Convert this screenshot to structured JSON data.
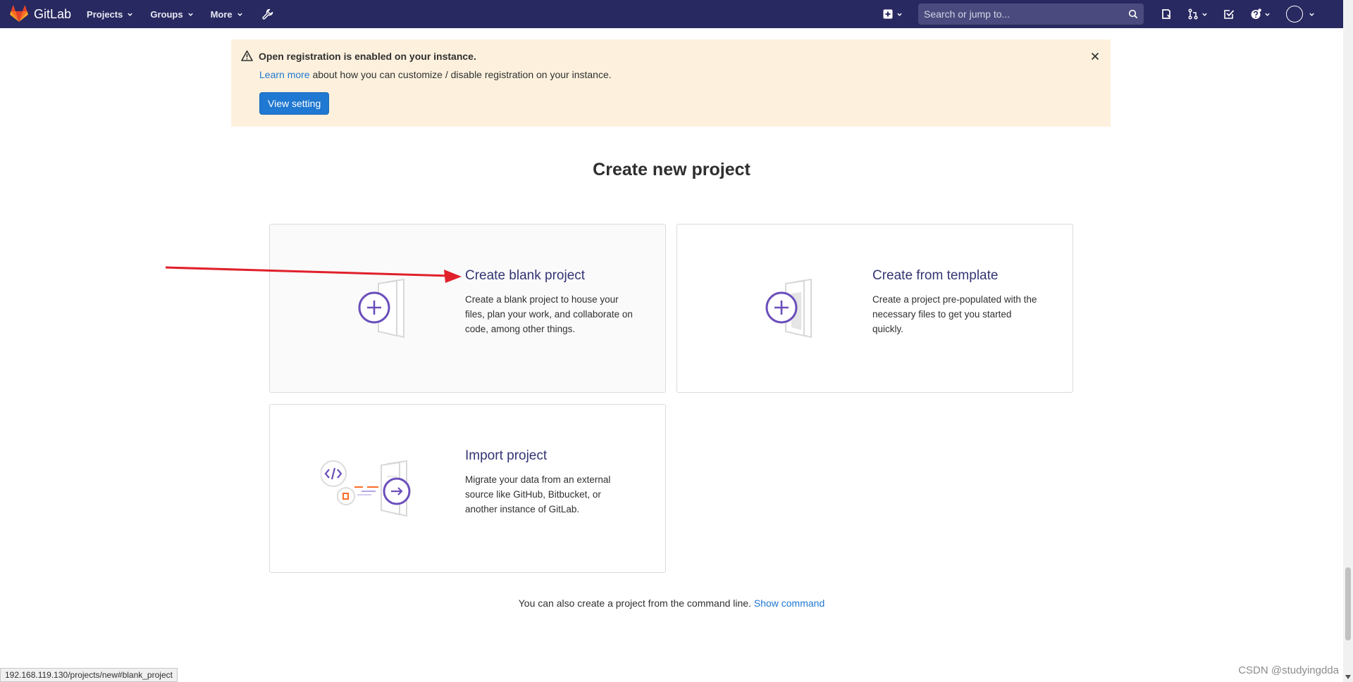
{
  "navbar": {
    "brand": "GitLab",
    "menus": [
      "Projects",
      "Groups",
      "More"
    ],
    "search_placeholder": "Search or jump to..."
  },
  "banner": {
    "title": "Open registration is enabled on your instance.",
    "link": "Learn more",
    "text": "about how you can customize / disable registration on your instance.",
    "button": "View setting"
  },
  "page": {
    "title": "Create new project"
  },
  "cards": {
    "blank": {
      "title": "Create blank project",
      "desc": "Create a blank project to house your files, plan your work, and collaborate on code, among other things."
    },
    "template": {
      "title": "Create from template",
      "desc": "Create a project pre-populated with the necessary files to get you started quickly."
    },
    "import": {
      "title": "Import project",
      "desc": "Migrate your data from an external source like GitHub, Bitbucket, or another instance of GitLab."
    }
  },
  "cli": {
    "text": "You can also create a project from the command line.",
    "link": "Show command"
  },
  "status_url": "192.168.119.130/projects/new#blank_project",
  "watermark": "CSDN @studyingdda",
  "colors": {
    "navbar": "#292961",
    "accent": "#6b4fbb",
    "link": "#1f78d1",
    "banner_bg": "#fdf1dd",
    "annotation_arrow": "#e0202a"
  }
}
